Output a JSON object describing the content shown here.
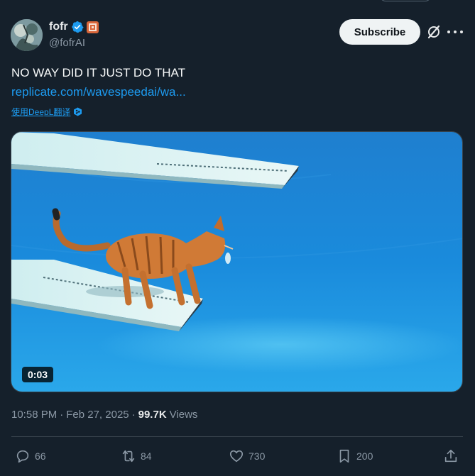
{
  "author": {
    "name": "fofr",
    "handle": "@fofrAI",
    "verified_icon": "verified-badge-icon",
    "affiliate_icon": "affiliate-badge-icon"
  },
  "header": {
    "subscribe_label": "Subscribe",
    "grok_icon": "grok-icon",
    "more_icon": "more-icon"
  },
  "tweet": {
    "text": "NO WAY DID IT JUST DO THAT",
    "link": "replicate.com/wavespeedai/wa...",
    "translate_label": "使用DeepL翻译"
  },
  "media": {
    "duration": "0:03",
    "description_icon": "video-thumbnail"
  },
  "meta": {
    "time": "10:58 PM",
    "sep1": "·",
    "date": "Feb 27, 2025",
    "sep2": "·",
    "views_count": "99.7K",
    "views_label": "Views"
  },
  "actions": {
    "replies": "66",
    "reposts": "84",
    "likes": "730",
    "bookmarks": "200"
  },
  "colors": {
    "background": "#15202b",
    "accent": "#1d9bf0",
    "muted": "#8b98a5",
    "text": "#e7e9ea"
  }
}
